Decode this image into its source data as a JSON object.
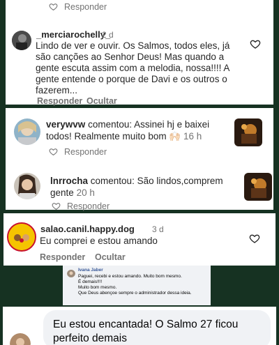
{
  "comments": [
    {
      "reply_label": "Responder"
    },
    {
      "username": "_merciarochelly_",
      "time": "2 d",
      "text": "Lindo de ver e ouvir. Os Salmos, todos eles, já são canções ao Senhor Deus! Mas quando a gente escuta assim com a melodia, nossa!!!! A gente entende o porque de Davi e os outros o fazerem...",
      "text_lines": [
        "Lindo de ver e ouvir. Os Salmos, todos eles, já",
        "são canções ao Senhor Deus! Mas quando a",
        "gente escuta assim com a melodia, nossa!!!! A",
        "gente entende o porque de Davi e os outros o",
        "fazerem..."
      ],
      "reply_label": "Responder",
      "hide_label": "Ocultar"
    },
    {
      "username": "verywvw",
      "action": "comentou:",
      "line1": "Assinei hj e baixei",
      "line2": "todos! Realmente muito bom",
      "emoji": "🙌🏻",
      "time": "16 h",
      "reply_label": "Responder"
    },
    {
      "username": "lnrrocha",
      "action": "comentou:",
      "line1": "São lindos,comprem",
      "line2": "gente",
      "time": "20 h",
      "reply_label": "Responder"
    },
    {
      "username": "salao.canil.happy.dog",
      "time": "3 d",
      "text": "Eu comprei e estou amando",
      "reply_label": "Responder",
      "hide_label": "Ocultar",
      "avatar_text": "HAPPY DOG"
    }
  ],
  "facebook_comment": {
    "name": "Ivana Jaber",
    "lines": [
      "Paguei, recebi e estou amando. Muito bom mesmo.",
      "É demais!!!!",
      "Muito bom mesmo.",
      "Que Deus abençoe sempre o administrador dessa ideia."
    ]
  },
  "last_comment": {
    "lines": [
      "Eu estou encantada! O Salmo 27 ficou",
      "perfeito demais"
    ]
  },
  "colors": {
    "background": "#163222",
    "text": "#262626",
    "secondary": "#737373",
    "heart": "#262626"
  }
}
